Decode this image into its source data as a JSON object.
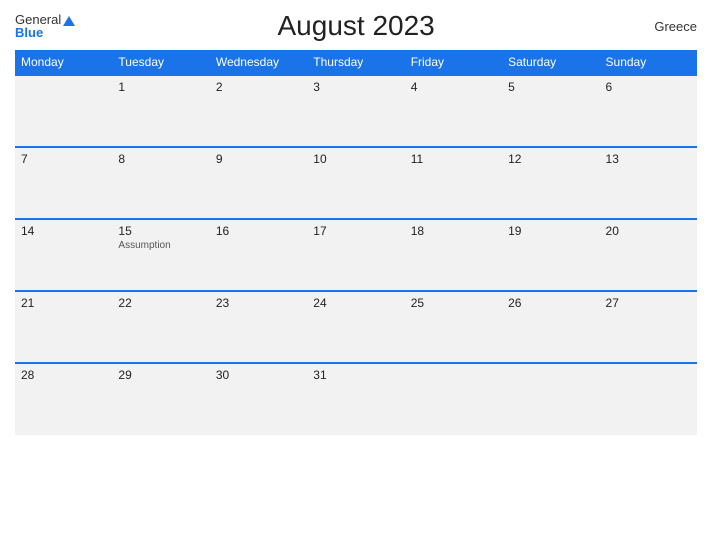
{
  "header": {
    "logo_general": "General",
    "logo_blue": "Blue",
    "title": "August 2023",
    "country": "Greece"
  },
  "weekdays": [
    "Monday",
    "Tuesday",
    "Wednesday",
    "Thursday",
    "Friday",
    "Saturday",
    "Sunday"
  ],
  "weeks": [
    [
      {
        "day": "",
        "holiday": ""
      },
      {
        "day": "1",
        "holiday": ""
      },
      {
        "day": "2",
        "holiday": ""
      },
      {
        "day": "3",
        "holiday": ""
      },
      {
        "day": "4",
        "holiday": ""
      },
      {
        "day": "5",
        "holiday": ""
      },
      {
        "day": "6",
        "holiday": ""
      }
    ],
    [
      {
        "day": "7",
        "holiday": ""
      },
      {
        "day": "8",
        "holiday": ""
      },
      {
        "day": "9",
        "holiday": ""
      },
      {
        "day": "10",
        "holiday": ""
      },
      {
        "day": "11",
        "holiday": ""
      },
      {
        "day": "12",
        "holiday": ""
      },
      {
        "day": "13",
        "holiday": ""
      }
    ],
    [
      {
        "day": "14",
        "holiday": ""
      },
      {
        "day": "15",
        "holiday": "Assumption"
      },
      {
        "day": "16",
        "holiday": ""
      },
      {
        "day": "17",
        "holiday": ""
      },
      {
        "day": "18",
        "holiday": ""
      },
      {
        "day": "19",
        "holiday": ""
      },
      {
        "day": "20",
        "holiday": ""
      }
    ],
    [
      {
        "day": "21",
        "holiday": ""
      },
      {
        "day": "22",
        "holiday": ""
      },
      {
        "day": "23",
        "holiday": ""
      },
      {
        "day": "24",
        "holiday": ""
      },
      {
        "day": "25",
        "holiday": ""
      },
      {
        "day": "26",
        "holiday": ""
      },
      {
        "day": "27",
        "holiday": ""
      }
    ],
    [
      {
        "day": "28",
        "holiday": ""
      },
      {
        "day": "29",
        "holiday": ""
      },
      {
        "day": "30",
        "holiday": ""
      },
      {
        "day": "31",
        "holiday": ""
      },
      {
        "day": "",
        "holiday": ""
      },
      {
        "day": "",
        "holiday": ""
      },
      {
        "day": "",
        "holiday": ""
      }
    ]
  ]
}
